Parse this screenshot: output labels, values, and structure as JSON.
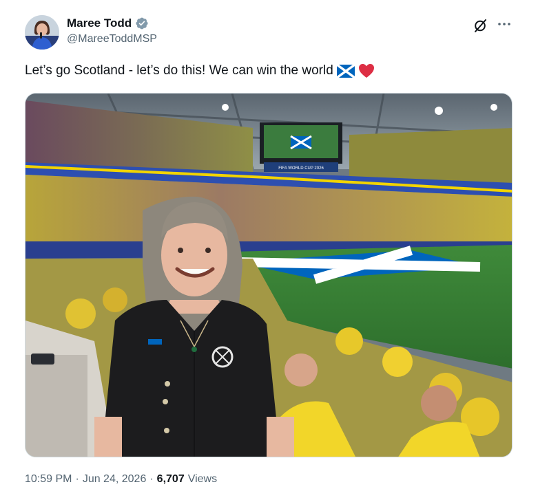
{
  "author": {
    "name": "Maree Todd",
    "handle": "@MareeToddMSP"
  },
  "icons": {
    "avatar": "user-avatar",
    "verified": "verified-badge-icon",
    "grok": "grok-icon",
    "more": "more-options-icon",
    "flag": "scotland-flag-emoji",
    "heart": "red-heart-emoji"
  },
  "tweet": {
    "text": "Let’s go Scotland - let’s do this! We can win the world"
  },
  "media": {
    "screen_text": "FIFA WORLD CUP 2026"
  },
  "meta": {
    "time": "10:59 PM",
    "separator": "·",
    "date": "Jun 24, 2026",
    "views_count": "6,707",
    "views_label": "Views"
  },
  "colors": {
    "verified": "#829aab",
    "text": "#0f1419",
    "secondary": "#536471",
    "heart": "#f91880",
    "saltire": "#0065bd"
  }
}
